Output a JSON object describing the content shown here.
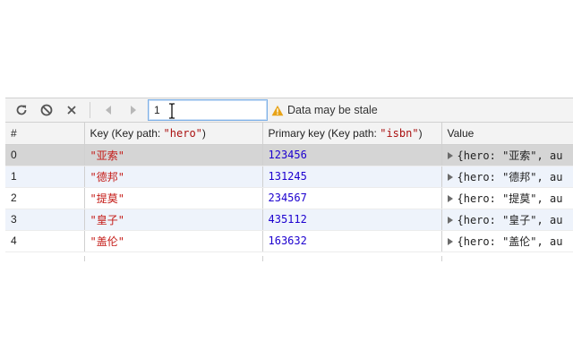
{
  "toolbar": {
    "refresh_icon": "refresh-icon",
    "clear_icon": "clear-icon",
    "delete_icon": "delete-icon",
    "prev_icon": "previous-page-icon",
    "next_icon": "next-page-icon",
    "key_input_value": "1",
    "stale_text": "Data may be stale",
    "warning_color": "#e8a317"
  },
  "table": {
    "headers": {
      "index": "#",
      "key_prefix": "Key (Key path: ",
      "key_path": "\"hero\"",
      "key_suffix": ")",
      "primary_prefix": "Primary key (Key path: ",
      "primary_path": "\"isbn\"",
      "primary_suffix": ")",
      "value": "Value"
    },
    "rows": [
      {
        "index": "0",
        "key": "\"亚索\"",
        "primary": "123456",
        "value": "{hero: \"亚索\", au"
      },
      {
        "index": "1",
        "key": "\"德邦\"",
        "primary": "131245",
        "value": "{hero: \"德邦\", au"
      },
      {
        "index": "2",
        "key": "\"提莫\"",
        "primary": "234567",
        "value": "{hero: \"提莫\", au"
      },
      {
        "index": "3",
        "key": "\"皇子\"",
        "primary": "435112",
        "value": "{hero: \"皇子\", au"
      },
      {
        "index": "4",
        "key": "\"盖伦\"",
        "primary": "163632",
        "value": "{hero: \"盖伦\", au"
      }
    ]
  }
}
